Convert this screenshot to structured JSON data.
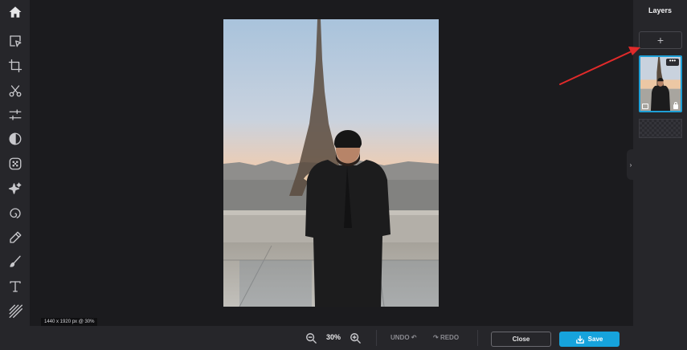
{
  "panel": {
    "title": "Layers",
    "add_label": "+",
    "more_label": "•••"
  },
  "canvas": {
    "dimensions": "1440 x 1920 px @ 30%"
  },
  "bottombar": {
    "zoom": "30%",
    "undo_label": "UNDO",
    "redo_label": "REDO",
    "close_label": "Close",
    "save_label": "Save"
  },
  "toolbar": {
    "tools": [
      "home-icon",
      "select-icon",
      "crop-icon",
      "cut-icon",
      "adjust-icon",
      "contrast-icon",
      "texture-icon",
      "effects-icon",
      "spiral-icon",
      "retouch-icon",
      "brush-icon",
      "text-icon",
      "pattern-icon"
    ]
  },
  "colors": {
    "accent": "#16a3dc",
    "panel": "#26262a",
    "canvas": "#1b1b1e",
    "annotation": "#e02a2a"
  }
}
